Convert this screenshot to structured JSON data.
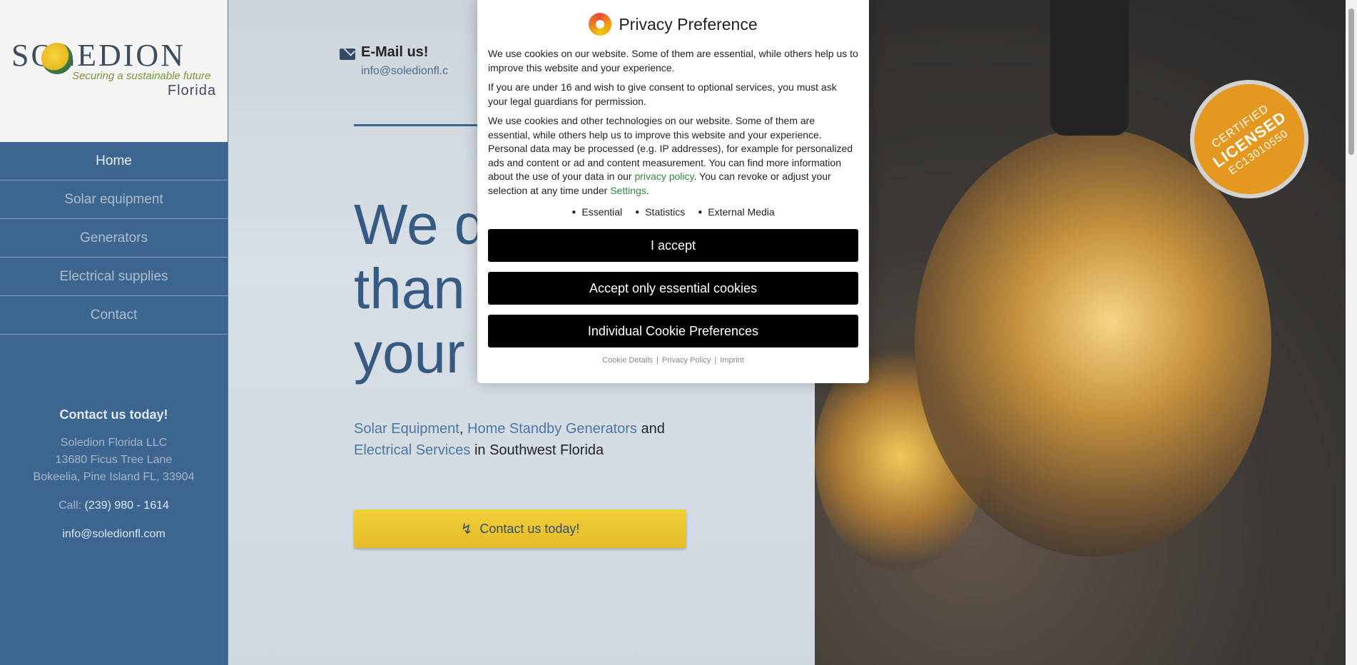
{
  "brand": {
    "name": "SOLEDION",
    "tagline": "Securing a sustainable future",
    "region": "Florida"
  },
  "nav": [
    {
      "label": "Home",
      "active": true
    },
    {
      "label": "Solar equipment"
    },
    {
      "label": "Generators"
    },
    {
      "label": "Electrical supplies"
    },
    {
      "label": "Contact"
    }
  ],
  "sidebar_contact": {
    "title": "Contact us today!",
    "company": "Soledion Florida LLC",
    "street": "13680 Ficus Tree Lane",
    "city": "Bokeelia, Pine Island FL, 33904",
    "call_label": "Call:",
    "phone": "(239) 980 - 1614",
    "email": "info@soledionfl.com"
  },
  "header_contact": {
    "title": "E-Mail us!",
    "email": "info@soledionfl.c"
  },
  "hero": {
    "heading_line1": "We d",
    "heading_line2": "than",
    "heading_line3": "your",
    "sub_link1": "Solar Equipment",
    "sub_sep1": ", ",
    "sub_link2": "Home Standby Generators",
    "sub_and": " and ",
    "sub_link3": "Electrical Services",
    "sub_tail": " in Southwest Florida",
    "cta": "Contact us today!"
  },
  "badge": {
    "line1": "CERTIFIED",
    "line2": "LICENSED",
    "line3": "EC13010550"
  },
  "privacy_dialog": {
    "title": "Privacy Preference",
    "p1": "We use cookies on our website. Some of them are essential, while others help us to improve this website and your experience.",
    "p2": "If you are under 16 and wish to give consent to optional services, you must ask your legal guardians for permission.",
    "p3_start": "We use cookies and other technologies on our website. Some of them are essential, while others help us to improve this website and your experience. Personal data may be processed (e.g. IP addresses), for example for personalized ads and content or ad and content measurement. You can find more information about the use of your data in our ",
    "p3_link": "privacy policy",
    "p3_mid": ". You can revoke or adjust your selection at any time under ",
    "p3_settings": "Settings",
    "p3_end": ".",
    "groups": [
      "Essential",
      "Statistics",
      "External Media"
    ],
    "accept_all": "I accept",
    "accept_essential": "Accept only essential cookies",
    "individual": "Individual Cookie Preferences",
    "footer_links": [
      "Cookie Details",
      "Privacy Policy",
      "Imprint"
    ],
    "footer_sep": "|"
  },
  "colors": {
    "sidebar": "#2c5a87",
    "accent_yellow": "#e8bc1c",
    "link_green": "#2e8b3e",
    "button_black": "#000000"
  }
}
